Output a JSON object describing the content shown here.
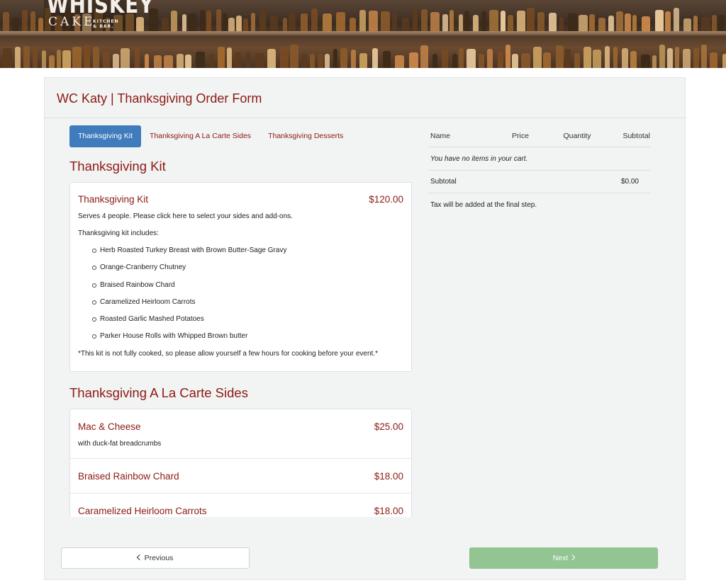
{
  "brand": {
    "logo_top": "WHISKEY",
    "logo_bottom": "CAKE",
    "logo_side_1": "KITCHEN",
    "logo_side_2": "& BAR.",
    "accent_color": "#8b1a14",
    "active_tab_color": "#3f7bbd",
    "next_button_color": "#92c592"
  },
  "page": {
    "title": "WC Katy | Thanksgiving Order Form"
  },
  "tabs": [
    {
      "label": "Thanksgiving Kit",
      "active": true
    },
    {
      "label": "Thanksgiving A La Carte Sides",
      "active": false
    },
    {
      "label": "Thanksgiving Desserts",
      "active": false
    }
  ],
  "kit_section": {
    "title": "Thanksgiving Kit",
    "item": {
      "name": "Thanksgiving Kit",
      "price": "$120.00",
      "description": "Serves 4 people. Please click here to select your sides and add-ons.",
      "includes_label": "Thanksgiving kit includes:",
      "includes": [
        "Herb Roasted Turkey Breast with Brown Butter-Sage Gravy",
        "Orange-Cranberry Chutney",
        "Braised Rainbow Chard",
        "Caramelized Heirloom Carrots",
        "Roasted Garlic Mashed Potatoes",
        "Parker House Rolls with Whipped Brown butter"
      ],
      "note": "*This kit is not fully cooked, so please allow yourself a few hours for cooking before your event.*"
    }
  },
  "sides_section": {
    "title": "Thanksgiving A La Carte Sides",
    "items": [
      {
        "name": "Mac & Cheese",
        "price": "$25.00",
        "description": "with duck-fat breadcrumbs"
      },
      {
        "name": "Braised Rainbow Chard",
        "price": "$18.00"
      },
      {
        "name": "Caramelized Heirloom Carrots",
        "price": "$18.00"
      }
    ]
  },
  "cart": {
    "headers": {
      "name": "Name",
      "price": "Price",
      "quantity": "Quantity",
      "subtotal": "Subtotal"
    },
    "empty_message": "You have no items in your cart.",
    "subtotal_label": "Subtotal",
    "subtotal_value": "$0.00",
    "tax_note": "Tax will be added at the final step."
  },
  "footer": {
    "previous_label": "Previous",
    "next_label": "Next"
  }
}
